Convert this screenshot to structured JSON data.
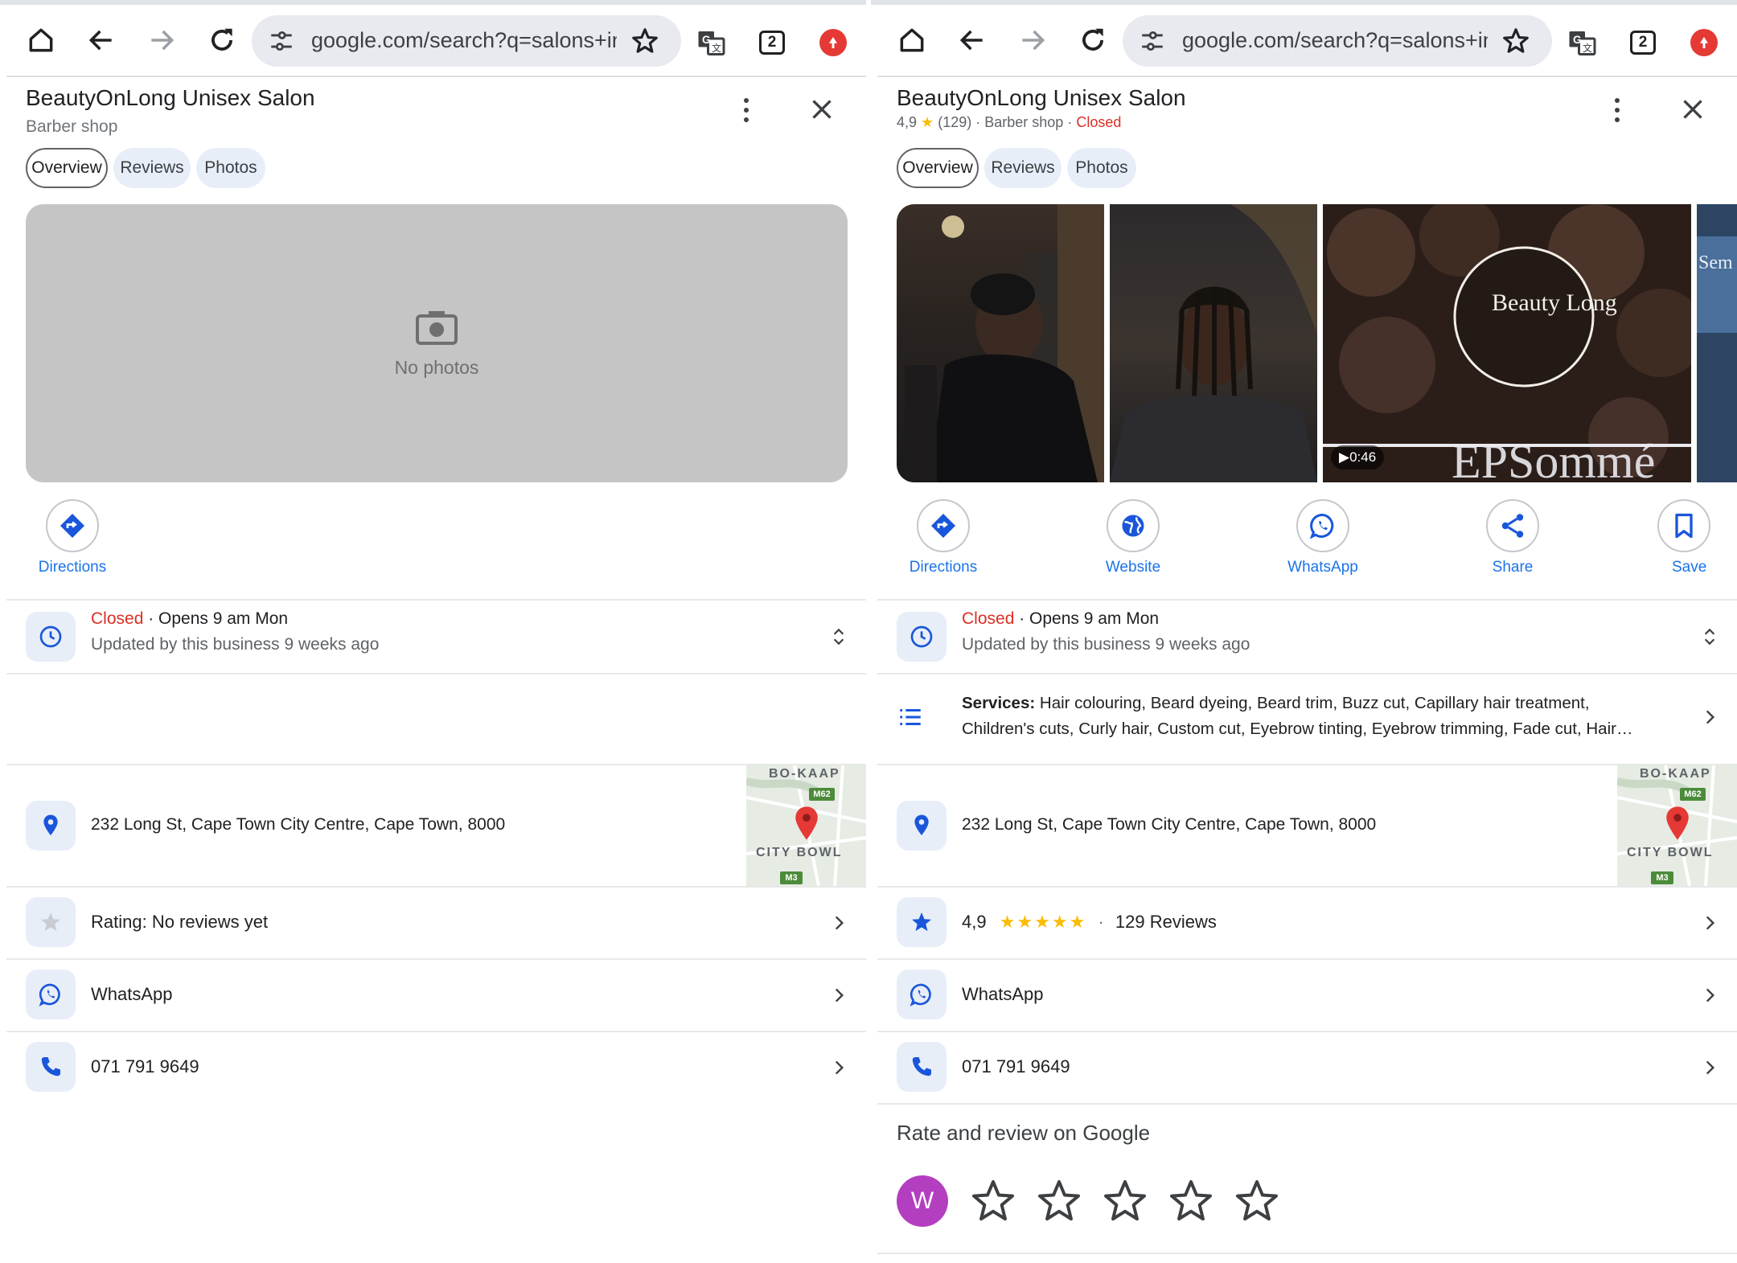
{
  "browser": {
    "url": "google.com/search?q=salons+in+",
    "tab_count": "2"
  },
  "left": {
    "business_name": "BeautyOnLong Unisex Salon",
    "category": "Barber shop",
    "tabs": [
      "Overview",
      "Reviews",
      "Photos"
    ],
    "no_photos_label": "No photos",
    "actions": [
      "Directions"
    ],
    "hours_status": "Closed",
    "hours_next": " · Opens 9 am Mon",
    "hours_updated": "Updated by this business 9 weeks ago",
    "address": "232 Long St, Cape Town City Centre, Cape Town, 8000",
    "map_labels": [
      "BO-KAAP",
      "CITY BOWL",
      "M62",
      "M3"
    ],
    "rating_text": "Rating: No reviews yet",
    "whatsapp": "WhatsApp",
    "phone": "071 791 9649"
  },
  "right": {
    "business_name": "BeautyOnLong Unisex Salon",
    "rating": "4,9",
    "review_count": "(129)",
    "category": "Barber shop",
    "status": "Closed",
    "tabs": [
      "Overview",
      "Reviews",
      "Photos"
    ],
    "video_duration": "0:46",
    "photo_sign_text": "Beauty Long",
    "actions": [
      "Directions",
      "Website",
      "WhatsApp",
      "Share",
      "Save"
    ],
    "hours_status": "Closed",
    "hours_next": " · Opens 9 am Mon",
    "hours_updated": "Updated by this business 9 weeks ago",
    "services_label": "Services:",
    "services_line1": " Hair colouring, Beard dyeing, Beard trim, Buzz cut, Capillary hair treatment,",
    "services_line2": "Children's cuts, Curly hair, Custom cut, Eyebrow tinting, Eyebrow trimming, Fade cut, Hair…",
    "address": "232 Long St, Cape Town City Centre, Cape Town, 8000",
    "map_labels": [
      "BO-KAAP",
      "CITY BOWL",
      "M62",
      "M3"
    ],
    "rating_row_value": "4,9",
    "rating_row_stars": "★★★★★",
    "rating_row_reviews": "129 Reviews",
    "whatsapp": "WhatsApp",
    "phone": "071 791 9649",
    "rate_review_title": "Rate and review on Google",
    "avatar_initial": "W"
  },
  "colors": {
    "link_blue": "#1a73e8",
    "closed_red": "#d93025",
    "star_yellow": "#fbbc04",
    "chip_bg": "#e8eef8",
    "avatar_purple": "#b33fc0"
  }
}
